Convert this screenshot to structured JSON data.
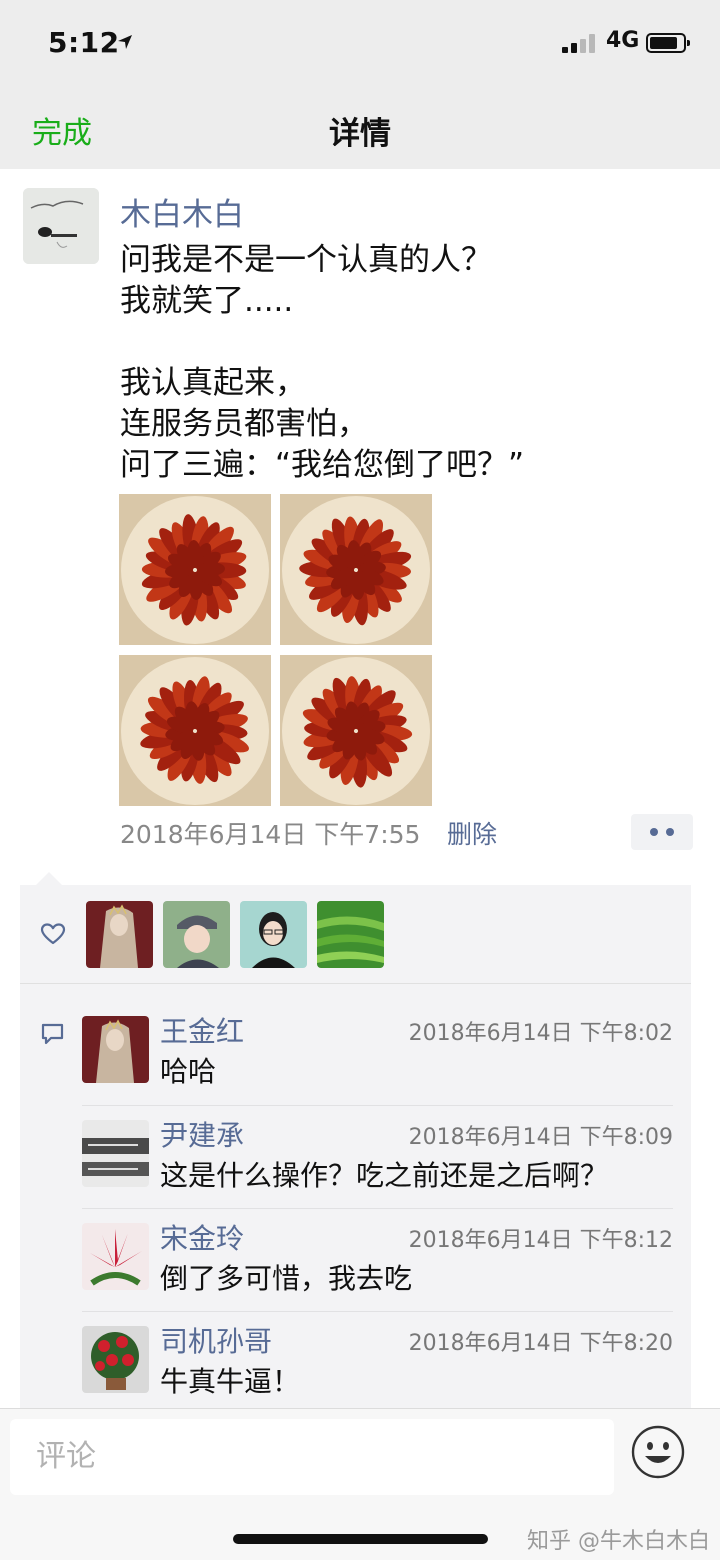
{
  "status_bar": {
    "time": "5:12",
    "network": "4G",
    "signal_bars_filled": 2,
    "signal_bars_total": 4,
    "battery_level": 0.85
  },
  "nav": {
    "done_label": "完成",
    "title": "详情"
  },
  "post": {
    "author": "木白木白",
    "lines": [
      "问我是不是一个认真的人？",
      "我就笑了.....",
      "",
      "我认真起来，",
      "连服务员都害怕，",
      "问了三遍：“我给您倒了吧？”"
    ],
    "photos": [
      {
        "name": "crayfish-photo-1"
      },
      {
        "name": "crayfish-photo-2"
      },
      {
        "name": "crayfish-photo-3"
      },
      {
        "name": "crayfish-photo-4"
      }
    ],
    "time": "2018年6月14日 下午7:55",
    "delete_label": "删除"
  },
  "likes": {
    "icon": "heart-icon",
    "avatars": [
      "like-avatar-1",
      "like-avatar-2",
      "like-avatar-3",
      "like-avatar-4"
    ]
  },
  "comments": [
    {
      "name": "王金红",
      "time": "2018年6月14日 下午8:02",
      "text": "哈哈"
    },
    {
      "name": "尹建承",
      "time": "2018年6月14日 下午8:09",
      "text": "这是什么操作？吃之前还是之后啊？"
    },
    {
      "name": "宋金玲",
      "time": "2018年6月14日 下午8:12",
      "text": "倒了多可惜，我去吃"
    },
    {
      "name": "司机孙哥",
      "time": "2018年6月14日 下午8:20",
      "text": "牛真牛逼！"
    }
  ],
  "bottom": {
    "input_placeholder": "评论",
    "watermark": "知乎 @牛木白木白"
  },
  "colors": {
    "accent_green": "#19ad19",
    "link_blue": "#576b95",
    "nav_bg": "#ededed",
    "panel_bg": "#f3f3f5"
  }
}
